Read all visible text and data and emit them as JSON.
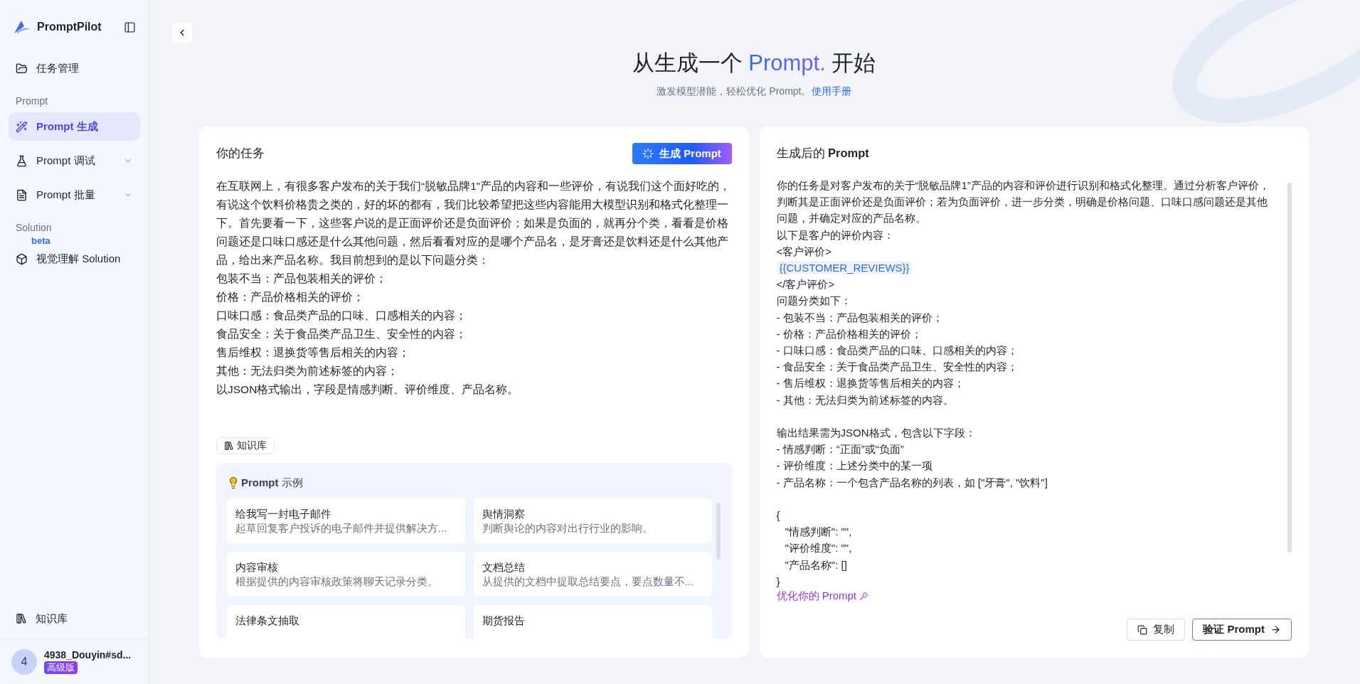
{
  "sidebar": {
    "logo": "PromptPilot",
    "sections": [
      {
        "items": [
          {
            "label": "任务管理",
            "kind": "link",
            "selected": false
          }
        ]
      },
      {
        "heading": "Prompt",
        "items": [
          {
            "label": "Prompt 生成",
            "kind": "link",
            "selected": true
          },
          {
            "label": "Prompt 调试",
            "kind": "expandable",
            "selected": false,
            "expanded": false
          },
          {
            "label": "Prompt 批量",
            "kind": "expandable",
            "selected": false,
            "expanded": false
          }
        ]
      },
      {
        "heading": "Solution",
        "items": [
          {
            "label": "视觉理解 Solution",
            "kind": "link",
            "selected": false,
            "badge": "beta"
          }
        ]
      }
    ],
    "bottom_item": "知识库",
    "user": {
      "avatar": "4",
      "name": "4938_Douyin#sd...",
      "plan": "高级版"
    }
  },
  "header": {
    "title_before": "从生成一个 ",
    "title_highlight": "Prompt.",
    "title_after": " 开始",
    "subtitle": "激发模型潜能，轻松优化 Prompt。",
    "subtitle_link": "使用手册"
  },
  "task_card": {
    "title": "你的任务",
    "generate_button": "生成 Prompt",
    "paragraphs": [
      "在互联网上，有很多客户发布的关于我们“脱敏品牌1”产品的内容和一些评价，有说我们这个面好吃的，有说这个饮料价格贵之类的，好的坏的都有，我们比较希望把这些内容能用大模型识别和格式化整理一下。首先要看一下，这些客户说的是正面评价还是负面评价；如果是负面的，就再分个类，看看是价格问题还是口味口感还是什么其他问题，然后看看对应的是哪个产品名，是牙膏还是饮料还是什么其他产品，给出来产品名称。我目前想到的是以下问题分类：",
      "包装不当：产品包装相关的评价；",
      "价格：产品价格相关的评价；",
      "口味口感：食品类产品的口味、口感相关的内容；",
      "食品安全：关于食品类产品卫生、安全性的内容；",
      "售后维权：退换货等售后相关的内容；",
      "其他：无法归类为前述标签的内容；",
      "以JSON格式输出，字段是情感判断、评价维度、产品名称。"
    ],
    "knowledge_chip": "知识库",
    "examples": {
      "title": "**Prompt** 示例",
      "items": [
        {
          "title": "给我写一封电子邮件",
          "description": "起草回复客户投诉的电子邮件并提供解决方..."
        },
        {
          "title": "舆情洞察",
          "description": "判断舆论的内容对出行行业的影响。"
        },
        {
          "title": "内容审核",
          "description": "根据提供的内容审核政策将聊天记录分类。"
        },
        {
          "title": "文档总结",
          "description": "从提供的文档中提取总结要点，要点数量不..."
        },
        {
          "title": "法律条文抽取"
        },
        {
          "title": "期货报告"
        }
      ]
    }
  },
  "output_card": {
    "title": "生成后的 **Prompt**",
    "lines": [
      {
        "kind": "text",
        "text": "你的任务是对客户发布的关于“脱敏品牌1”产品的内容和评价进行识别和格式化整理。通过分析客户评价，判断其是正面评价还是负面评价；若为负面评价，进一步分类，明确是价格问题、口味口感问题还是其他问题，并确定对应的产品名称。"
      },
      {
        "kind": "text",
        "text": "以下是客户的评价内容："
      },
      {
        "kind": "text",
        "text": "<客户评价>"
      },
      {
        "kind": "variable",
        "text": "{{CUSTOMER_REVIEWS}}"
      },
      {
        "kind": "text",
        "text": "</客户评价>"
      },
      {
        "kind": "text",
        "text": "问题分类如下："
      },
      {
        "kind": "text",
        "text": "- 包装不当：产品包装相关的评价；"
      },
      {
        "kind": "text",
        "text": "- 价格：产品价格相关的评价；"
      },
      {
        "kind": "text",
        "text": "- 口味口感：食品类产品的口味、口感相关的内容；"
      },
      {
        "kind": "text",
        "text": "- 食品安全：关于食品类产品卫生、安全性的内容；"
      },
      {
        "kind": "text",
        "text": "- 售后维权：退换货等售后相关的内容；"
      },
      {
        "kind": "text",
        "text": "- 其他：无法归类为前述标签的内容。"
      },
      {
        "kind": "blank"
      },
      {
        "kind": "text",
        "text": "输出结果需为JSON格式，包含以下字段："
      },
      {
        "kind": "text",
        "text": "- 情感判断：“正面”或“负面”"
      },
      {
        "kind": "text",
        "text": "- 评价维度：上述分类中的某一项"
      },
      {
        "kind": "text",
        "text": "- 产品名称：一个包含产品名称的列表，如 [\"牙膏\", \"饮料\"]"
      },
      {
        "kind": "blank"
      },
      {
        "kind": "text",
        "text": "{"
      },
      {
        "kind": "indented",
        "text": "\"情感判断\": \"\","
      },
      {
        "kind": "indented",
        "text": "\"评价维度\": \"\","
      },
      {
        "kind": "indented",
        "text": "\"产品名称\": []"
      },
      {
        "kind": "text",
        "text": "}"
      }
    ],
    "optimize_link": "优化你的 Prompt",
    "buttons": [
      {
        "label": "复制",
        "kind": "secondary"
      },
      {
        "label": "验证 Prompt",
        "kind": "primary"
      }
    ]
  }
}
